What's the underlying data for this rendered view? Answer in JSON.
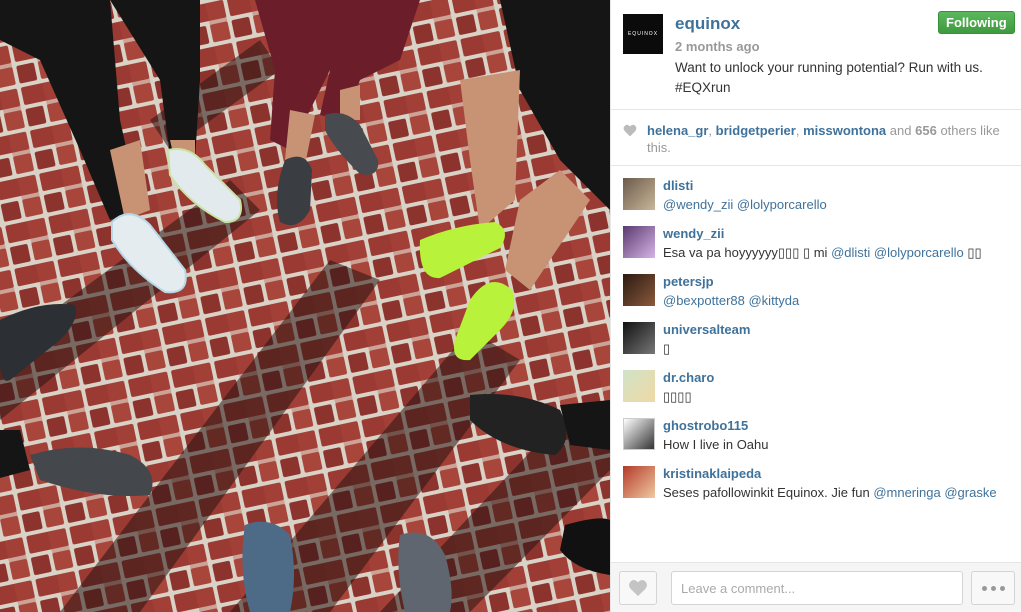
{
  "post": {
    "username": "equinox",
    "avatar_text": "EQUINOX",
    "time_ago": "2 months ago",
    "caption_lines": [
      "Want to unlock your running potential? Run with us.",
      "#EQXrun"
    ],
    "follow_button": "Following"
  },
  "likes": {
    "users": [
      "helena_gr",
      "bridgetperier",
      "misswontona"
    ],
    "and_text": "and",
    "count": "656",
    "others_text": "others like this."
  },
  "comments": [
    {
      "user": "dlisti",
      "text_before": "",
      "mentions": [
        "@wendy_zii",
        "@lolyporcarello"
      ],
      "text_after": ""
    },
    {
      "user": "wendy_zii",
      "text_before": "Esa va pa hoyyyyyy▯▯▯      ▯ mi",
      "mentions": [
        "@dlisti",
        "@lolyporcarello"
      ],
      "text_after": "▯▯"
    },
    {
      "user": "petersjp",
      "text_before": "",
      "mentions": [
        "@bexpotter88",
        "@kittyda"
      ],
      "text_after": ""
    },
    {
      "user": "universalteam",
      "text_before": "▯",
      "mentions": [],
      "text_after": ""
    },
    {
      "user": "dr.charo",
      "text_before": "▯▯▯▯",
      "mentions": [],
      "text_after": ""
    },
    {
      "user": "ghostrobo115",
      "text_before": "How I live in Oahu",
      "mentions": [],
      "text_after": ""
    },
    {
      "user": "kristinaklaipeda",
      "text_before": "Seses pafollowinkit Equinox. Jie fun",
      "mentions": [
        "@mneringa",
        "@graske"
      ],
      "text_after": ""
    }
  ],
  "footer": {
    "comment_placeholder": "Leave a comment..."
  },
  "icons": {
    "like": "heart-icon",
    "more": "more-options-icon"
  },
  "colors": {
    "link": "#3f729b",
    "follow_green": "#4cae4c",
    "muted": "#999999"
  }
}
